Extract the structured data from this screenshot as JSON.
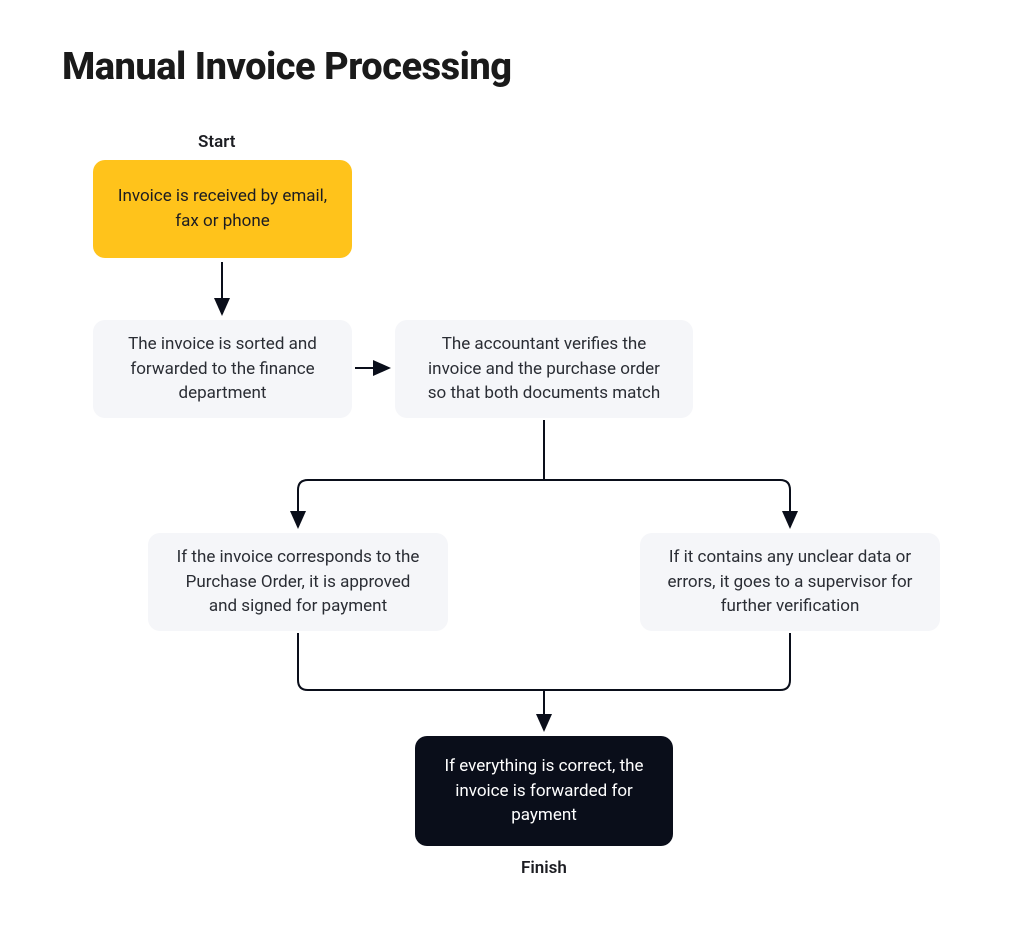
{
  "title": "Manual Invoice Processing",
  "labels": {
    "start": "Start",
    "finish": "Finish"
  },
  "nodes": {
    "received": "Invoice is received by email, fax or phone",
    "sorted": "The invoice is sorted and forwarded to the finance department",
    "verify": "The accountant verifies the invoice and the purchase order so that both documents match",
    "approved": "If the invoice corresponds to the Purchase Order, it is approved and signed for payment",
    "errors": "If it contains any unclear data or errors, it goes to a supervisor for further verification",
    "forward": "If everything is correct, the invoice is forwarded for payment"
  }
}
